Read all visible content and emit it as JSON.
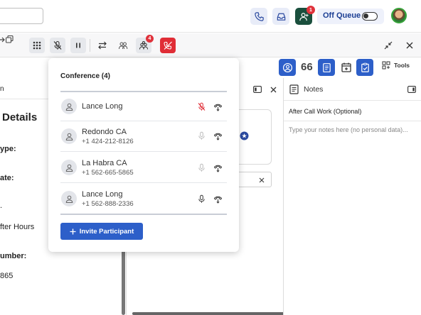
{
  "header": {
    "search_placeholder": "",
    "agent_badge_count": "1",
    "queue_label": "Off Queue"
  },
  "call_controls": {
    "conference_badge_count": "4"
  },
  "toolstrip": {
    "counter": "66",
    "tools_label": "Tools"
  },
  "left_panel": {
    "header_fragment": "n",
    "title": "Details",
    "fields": [
      {
        "label": "ype:"
      },
      {
        "label": "ate:"
      },
      {
        "value": "fter Hours"
      },
      {
        "label": "umber:"
      },
      {
        "value": "865"
      }
    ]
  },
  "notes": {
    "title": "Notes",
    "section": "After Call Work (Optional)",
    "placeholder": "Type your notes here (no personal data)..."
  },
  "conference": {
    "title": "Conference (4)",
    "participants": [
      {
        "name": "Lance Long",
        "phone": "",
        "muted": true
      },
      {
        "name": "Redondo CA",
        "phone": "+1 424-212-8126",
        "muted": false
      },
      {
        "name": "La Habra CA",
        "phone": "+1 562-665-5865",
        "muted": false
      },
      {
        "name": "Lance Long",
        "phone": "+1 562-888-2336",
        "muted": false
      }
    ],
    "invite_label": "Invite Participant"
  },
  "colors": {
    "primary": "#2d5fc9",
    "danger": "#e02d36",
    "agent_green": "#1a4f3d"
  }
}
